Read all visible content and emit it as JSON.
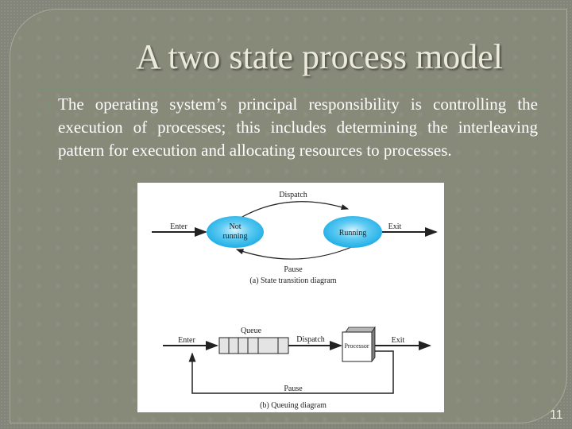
{
  "slide": {
    "title": "A two state process model",
    "bullet_text": "The operating system’s principal responsibility is controlling the execution of processes; this includes determining the interleaving pattern for execution and allocating resources to processes.",
    "page_number": "11"
  },
  "figure": {
    "state_diagram": {
      "dispatch_label": "Dispatch",
      "enter_label": "Enter",
      "exit_label": "Exit",
      "pause_label": "Pause",
      "not_running_line1": "Not",
      "not_running_line2": "running",
      "running_label": "Running",
      "caption": "(a) State transition diagram",
      "state_color": "#1fb3ea"
    },
    "queuing_diagram": {
      "queue_label": "Queue",
      "enter_label": "Enter",
      "dispatch_label": "Dispatch",
      "processor_label": "Processor",
      "exit_label": "Exit",
      "pause_label": "Pause",
      "caption": "(b) Queuing diagram"
    }
  }
}
